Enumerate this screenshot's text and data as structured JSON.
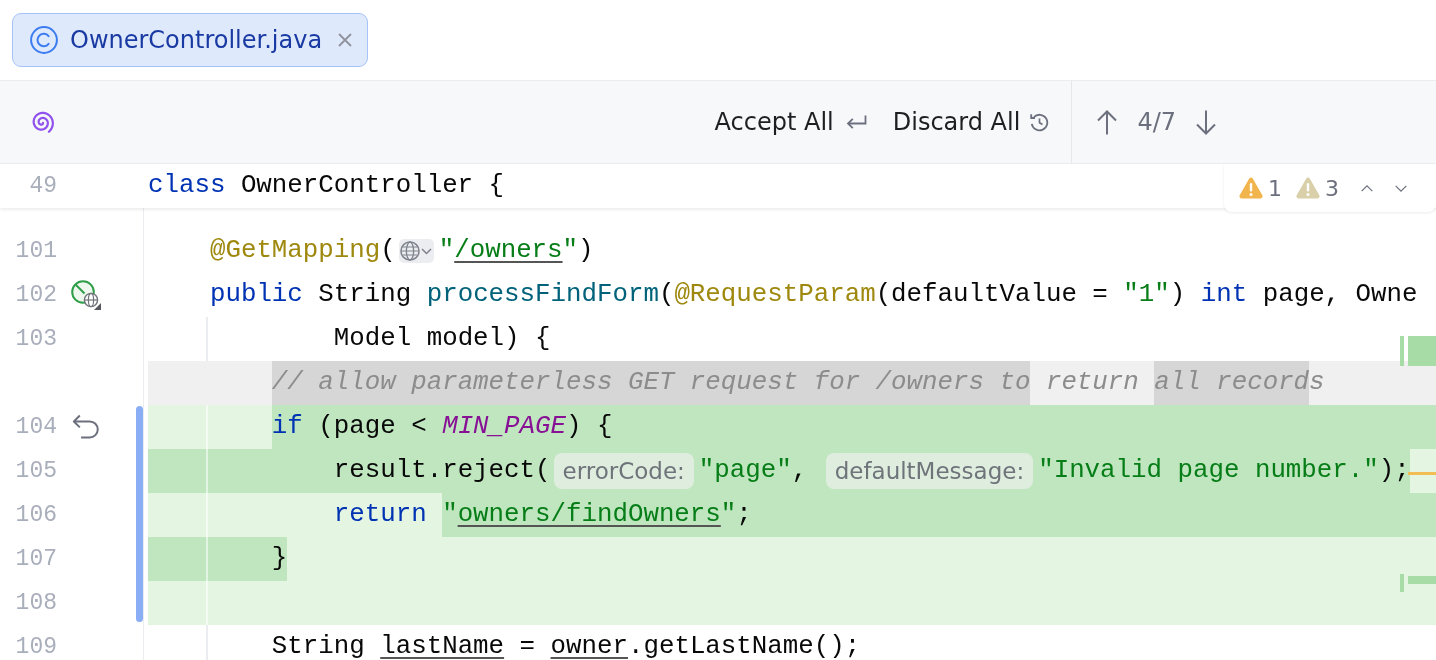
{
  "tabs": [
    {
      "label": "OwnerController.java",
      "selected": true
    }
  ],
  "toolbar": {
    "actions": [
      {
        "label": "Accept All",
        "kind": "accept"
      },
      {
        "label": "Discard All",
        "kind": "discard"
      }
    ],
    "counter": "4/7"
  },
  "sticky_line": {
    "number": "49",
    "tokens": [
      {
        "text": "class",
        "kind": "keyword"
      },
      {
        "text": " OwnerController {",
        "kind": "plain"
      }
    ]
  },
  "inspections": [
    {
      "count": "1",
      "kind": "warning"
    },
    {
      "count": "3",
      "kind": "weak_warning"
    }
  ],
  "lines": [
    {
      "number": "101",
      "kind": "context",
      "tokens": [
        {
          "text": "    @GetMapping",
          "kind": "annotation"
        },
        {
          "text": "(",
          "kind": "plain"
        },
        {
          "kind": "url_inlay"
        },
        {
          "text": "\"",
          "kind": "string"
        },
        {
          "text": "/owners",
          "kind": "string_link"
        },
        {
          "text": "\"",
          "kind": "string"
        },
        {
          "text": ")",
          "kind": "plain"
        }
      ]
    },
    {
      "number": "102",
      "kind": "context",
      "gutter": {
        "kind": "endpoint"
      },
      "tokens": [
        {
          "text": "    public",
          "kind": "keyword"
        },
        {
          "text": " String ",
          "kind": "plain"
        },
        {
          "text": "processFindForm",
          "kind": "method"
        },
        {
          "text": "(",
          "kind": "plain"
        },
        {
          "text": "@RequestParam",
          "kind": "annotation"
        },
        {
          "text": "(defaultValue = ",
          "kind": "plain"
        },
        {
          "text": "\"1\"",
          "kind": "string"
        },
        {
          "text": ") ",
          "kind": "plain"
        },
        {
          "text": "int",
          "kind": "keyword"
        },
        {
          "text": " page, Owne",
          "kind": "plain"
        }
      ]
    },
    {
      "number": "103",
      "kind": "context",
      "tokens": [
        {
          "text": "            Model model) {",
          "kind": "plain"
        }
      ]
    },
    {
      "kind": "deleted",
      "margin_changed": false,
      "tail_changed": false,
      "tokens": [
        {
          "text": "        // allow parameterless GET request for /owners to",
          "kind": "comment",
          "changed": true
        },
        {
          "text": " return ",
          "kind": "comment",
          "changed": false
        },
        {
          "text": "all record",
          "kind": "comment",
          "changed": true
        },
        {
          "text": "s",
          "kind": "comment",
          "changed": false
        }
      ]
    },
    {
      "number": "104",
      "kind": "added",
      "gutter": {
        "kind": "revert"
      },
      "margin_changed": false,
      "tail_changed": true,
      "tokens": [
        {
          "text": "        if",
          "kind": "keyword",
          "changed": true
        },
        {
          "text": " (page < ",
          "kind": "plain",
          "changed": true
        },
        {
          "text": "MIN_PAGE",
          "kind": "constant",
          "changed": true
        },
        {
          "text": ") {",
          "kind": "plain",
          "changed": true
        }
      ]
    },
    {
      "number": "105",
      "kind": "added",
      "margin_changed": true,
      "tail_changed": false,
      "tokens": [
        {
          "text": "            result.reject(",
          "kind": "plain",
          "changed": true
        },
        {
          "text": "errorCode:",
          "kind": "hint",
          "changed": true
        },
        {
          "text": "\"page\"",
          "kind": "string",
          "changed": true
        },
        {
          "text": ", ",
          "kind": "plain",
          "changed": true
        },
        {
          "text": "defaultMessage:",
          "kind": "hint",
          "changed": true
        },
        {
          "text": "\"Invalid page number.\"",
          "kind": "string",
          "changed": true
        },
        {
          "text": ");",
          "kind": "plain",
          "changed": true
        }
      ]
    },
    {
      "number": "106",
      "kind": "added",
      "margin_changed": false,
      "tail_changed": true,
      "tokens": [
        {
          "text": "            return ",
          "kind": "keyword",
          "changed": false
        },
        {
          "text": "\"",
          "kind": "string",
          "changed": true
        },
        {
          "text": "owners/findOwners",
          "kind": "string_link",
          "changed": true
        },
        {
          "text": "\"",
          "kind": "string",
          "changed": true
        },
        {
          "text": ";",
          "kind": "plain",
          "changed": true
        }
      ]
    },
    {
      "number": "107",
      "kind": "added",
      "margin_changed": true,
      "tail_changed": false,
      "tokens": [
        {
          "text": "        }",
          "kind": "plain",
          "changed": true
        }
      ]
    },
    {
      "number": "108",
      "kind": "added",
      "tail_changed": false
    },
    {
      "number": "109",
      "kind": "context",
      "tokens": [
        {
          "text": "        String ",
          "kind": "plain"
        },
        {
          "text": "lastName",
          "kind": "ref"
        },
        {
          "text": " = ",
          "kind": "plain"
        },
        {
          "text": "owner",
          "kind": "ref"
        },
        {
          "text": ".getLastName();",
          "kind": "plain"
        }
      ]
    }
  ]
}
